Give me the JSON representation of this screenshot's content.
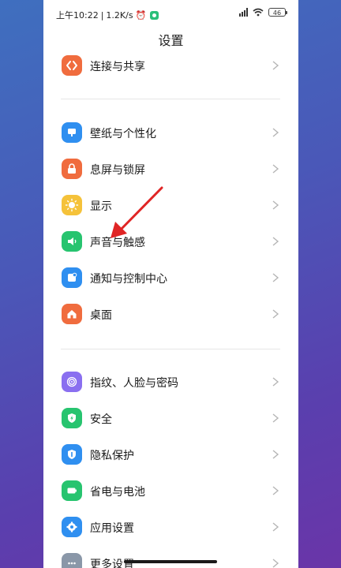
{
  "status": {
    "time": "上午10:22",
    "speed": "1.2K/s",
    "battery": "46"
  },
  "page": {
    "title": "设置"
  },
  "groups": [
    {
      "items": [
        {
          "label": "连接与共享",
          "icon": "share-icon",
          "color": "#f06c3e"
        }
      ]
    },
    {
      "items": [
        {
          "label": "壁纸与个性化",
          "icon": "wallpaper-icon",
          "color": "#2f8ff0"
        },
        {
          "label": "息屏与锁屏",
          "icon": "lock-icon",
          "color": "#f06c3e"
        },
        {
          "label": "显示",
          "icon": "sun-icon",
          "color": "#f5c23a"
        },
        {
          "label": "声音与触感",
          "icon": "speaker-icon",
          "color": "#27c46f"
        },
        {
          "label": "通知与控制中心",
          "icon": "notification-icon",
          "color": "#2f8ff0"
        },
        {
          "label": "桌面",
          "icon": "home-icon",
          "color": "#f06c3e"
        }
      ]
    },
    {
      "items": [
        {
          "label": "指纹、人脸与密码",
          "icon": "fingerprint-icon",
          "color": "#8a6ff0"
        },
        {
          "label": "安全",
          "icon": "shield-bolt-icon",
          "color": "#27c46f"
        },
        {
          "label": "隐私保护",
          "icon": "privacy-icon",
          "color": "#2f8ff0"
        },
        {
          "label": "省电与电池",
          "icon": "battery-icon",
          "color": "#27c46f"
        },
        {
          "label": "应用设置",
          "icon": "gear-icon",
          "color": "#2f8ff0"
        },
        {
          "label": "更多设置",
          "icon": "more-icon",
          "color": "#8a97a8"
        }
      ]
    }
  ]
}
